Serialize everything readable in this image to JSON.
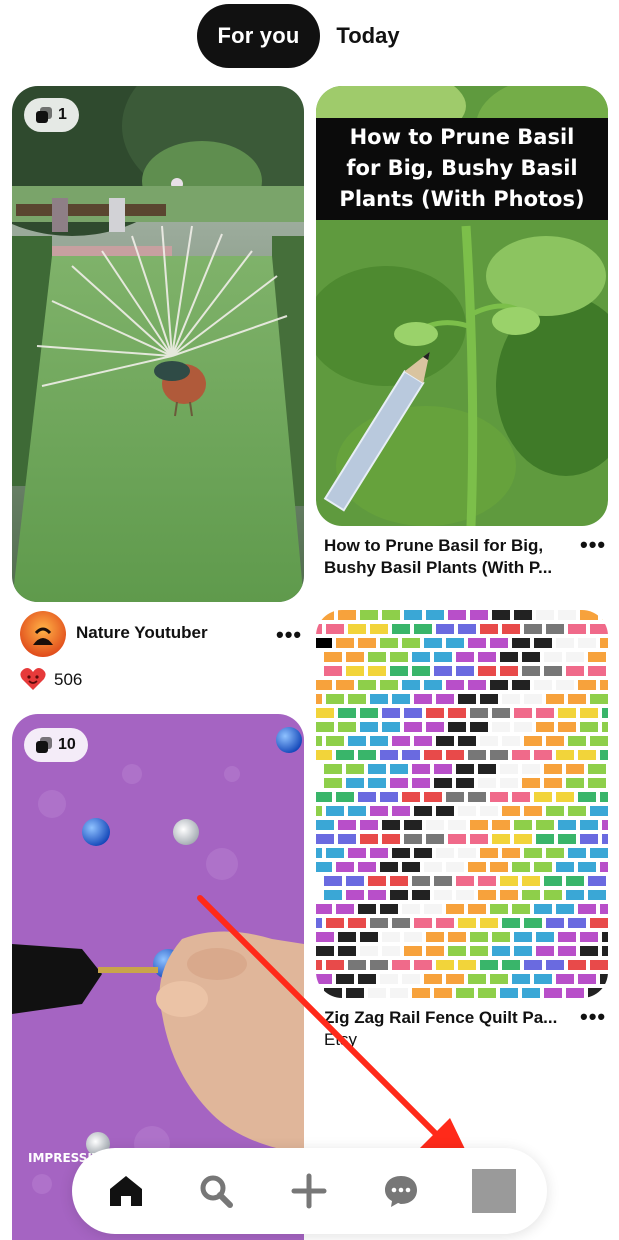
{
  "tabs": {
    "active": "For you",
    "inactive": "Today"
  },
  "pins": [
    {
      "badge_count": "1",
      "creator_name": "Nature Youtuber",
      "reaction_count": "506"
    },
    {
      "banner_text": "How to Prune Basil for Big, Bushy Basil Plants (With Photos)",
      "title": "How to Prune Basil for Big, Bushy Basil Plants (With P..."
    },
    {
      "badge_count": "10",
      "watermark": "IMPRESSIVE"
    },
    {
      "title": "Zig Zag Rail Fence Quilt Pa...",
      "source": "Etsy"
    }
  ],
  "more_label": "•••",
  "nav": {
    "items": [
      "home-icon",
      "search-icon",
      "plus-icon",
      "chat-icon",
      "profile-square"
    ],
    "active": "home-icon"
  },
  "colors": {
    "pill": "#111111",
    "accent_red": "#ff2a1a",
    "heart": "#e63a3a"
  }
}
